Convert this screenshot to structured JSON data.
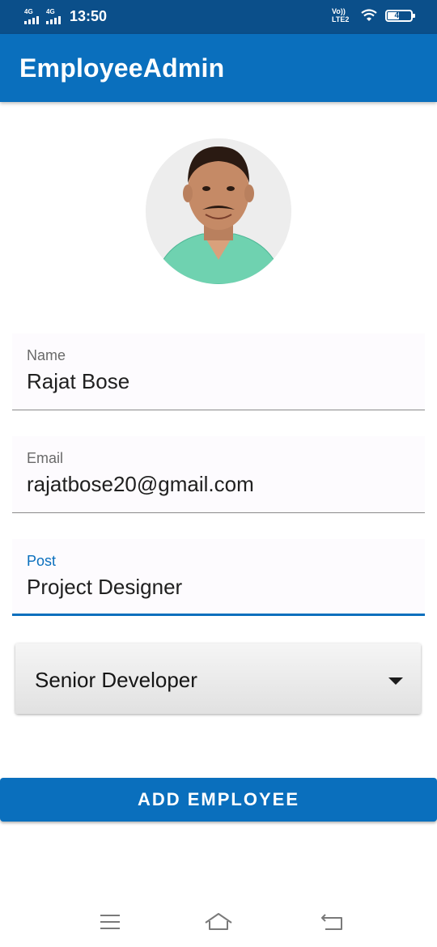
{
  "status_bar": {
    "network_1": "4G",
    "network_2": "4G",
    "time": "13:50",
    "volte_line1": "Vo))",
    "volte_line2": "LTE2",
    "battery": "48"
  },
  "app_bar": {
    "title": "EmployeeAdmin"
  },
  "avatar": {
    "icon": "profile-photo"
  },
  "form": {
    "name": {
      "label": "Name",
      "value": "Rajat Bose"
    },
    "email": {
      "label": "Email",
      "value": "rajatbose20@gmail.com"
    },
    "post": {
      "label": "Post",
      "value": "Project Designer"
    },
    "level": {
      "selected": "Senior Developer"
    }
  },
  "actions": {
    "add_label": "ADD EMPLOYEE"
  },
  "nav": {
    "icons": [
      "menu-icon",
      "home-icon",
      "back-icon"
    ]
  },
  "colors": {
    "primary": "#0a6fbd",
    "status_bar": "#0b4f8a",
    "field_bg": "#fdfbfe"
  }
}
